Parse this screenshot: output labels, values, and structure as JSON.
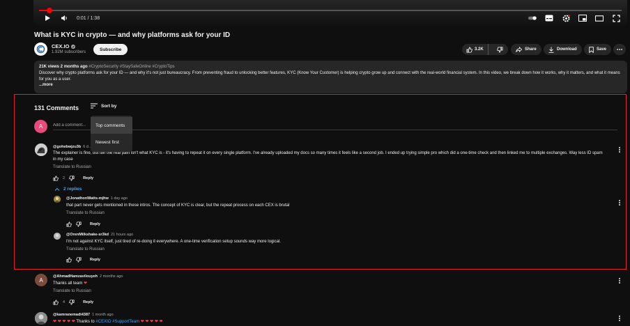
{
  "player": {
    "time_display": "0:01 / 1:38",
    "progress_fraction": 0.018
  },
  "video": {
    "title": "What is KYC in crypto — and why platforms ask for your ID"
  },
  "channel": {
    "name": "CEX.IO",
    "subscribers": "1.92M subscribers",
    "subscribe_label": "Subscribe"
  },
  "actions": {
    "like_count": "3.2K",
    "share_label": "Share",
    "download_label": "Download",
    "save_label": "Save"
  },
  "description": {
    "meta": "21K views  2 months ago",
    "tags": "#CryptoSecurity #StaySafeOnline #CryptoTips",
    "text": "Discover why crypto platforms ask for your ID — and why it's not just bureaucracy. From preventing fraud to unlocking better features, KYC (Know Your Customer) is helping crypto grow up and connect with the real-world financial system. In this video, we break down how it works, why it matters, and what it means for you as a user.",
    "more_label": "...more"
  },
  "comments": {
    "count_label": "131 Comments",
    "sort_label": "Sort by",
    "sort_options": [
      "Top comments",
      "Newest first"
    ],
    "user_initial": "A",
    "add_placeholder": "Add a comment...",
    "translate_label": "Translate to Russian",
    "reply_label": "Reply",
    "replies_toggle": "2 replies",
    "items": [
      {
        "author": "@gohebwjzu3b",
        "time": "6 d…",
        "text": "The explainer is fine, but tbh the real pain isn't what KYC is - it's having to repeat it on every single platform. I've already uploaded my docs so many times it feels like a second job. I ended up trying simple pro which did a one-time check and then linked me to multiple exchanges. Way less ID spam in my case",
        "likes": "2"
      },
      {
        "author": "@JonathonWatts-mjhw",
        "time": "1 day ago",
        "text": "that part never gets mentioned in these intros. The concept of KYC is clear, but the repeat process on each CEX is brutal",
        "likes": ""
      },
      {
        "author": "@OrenMilkshake-sr3kd",
        "time": "21 hours ago",
        "text": "I'm not against KYC itself, just tired of re-doing it everywhere. A one-time verification setup sounds way more logical.",
        "likes": ""
      },
      {
        "author": "@AhmadHamzavilouyeh",
        "time": "2 months ago",
        "text": "Thanks all team",
        "likes": "4",
        "initial": "A"
      },
      {
        "author": "@kamranemadi4387",
        "time": "1 month ago",
        "text_prefix": "Thanks to",
        "text_links": "#CEXIO #SupportTeam"
      }
    ]
  },
  "colors": {
    "background": "#0f0f0f",
    "highlight_border": "#e5202a",
    "link": "#3ea6ff",
    "heart": "#ff3b4a"
  }
}
